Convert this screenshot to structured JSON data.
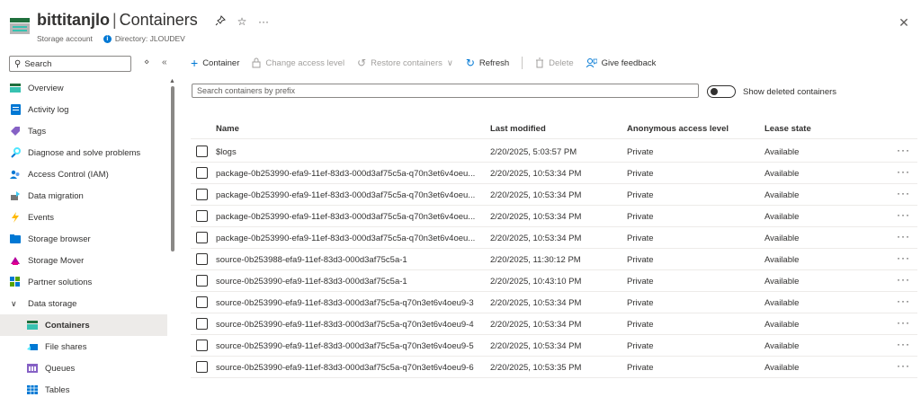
{
  "header": {
    "resource_name": "bittitanjlo",
    "separator": "|",
    "page_title": "Containers",
    "resource_type": "Storage account",
    "directory": "Directory: JLOUDEV"
  },
  "sidebar": {
    "search_placeholder": "Search",
    "items": [
      {
        "label": "Overview",
        "icon": "overview-icon"
      },
      {
        "label": "Activity log",
        "icon": "activity-log-icon"
      },
      {
        "label": "Tags",
        "icon": "tag-icon"
      },
      {
        "label": "Diagnose and solve problems",
        "icon": "wrench-icon"
      },
      {
        "label": "Access Control (IAM)",
        "icon": "people-icon"
      },
      {
        "label": "Data migration",
        "icon": "migration-icon"
      },
      {
        "label": "Events",
        "icon": "lightning-icon"
      },
      {
        "label": "Storage browser",
        "icon": "folder-icon"
      },
      {
        "label": "Storage Mover",
        "icon": "mover-icon"
      },
      {
        "label": "Partner solutions",
        "icon": "grid-icon"
      },
      {
        "label": "Data storage",
        "icon": "chevron-down-icon"
      },
      {
        "label": "Containers",
        "icon": "container-icon"
      },
      {
        "label": "File shares",
        "icon": "file-share-icon"
      },
      {
        "label": "Queues",
        "icon": "queue-icon"
      },
      {
        "label": "Tables",
        "icon": "table-icon"
      }
    ]
  },
  "toolbar": {
    "container": "Container",
    "change_access": "Change access level",
    "restore": "Restore containers",
    "refresh": "Refresh",
    "delete": "Delete",
    "feedback": "Give feedback"
  },
  "filter": {
    "placeholder": "Search containers by prefix",
    "toggle_label": "Show deleted containers"
  },
  "table": {
    "columns": [
      "Name",
      "Last modified",
      "Anonymous access level",
      "Lease state"
    ],
    "rows": [
      {
        "name": "$logs",
        "modified": "2/20/2025, 5:03:57 PM",
        "access": "Private",
        "lease": "Available"
      },
      {
        "name": "package-0b253990-efa9-11ef-83d3-000d3af75c5a-q70n3et6v4oeu...",
        "modified": "2/20/2025, 10:53:34 PM",
        "access": "Private",
        "lease": "Available"
      },
      {
        "name": "package-0b253990-efa9-11ef-83d3-000d3af75c5a-q70n3et6v4oeu...",
        "modified": "2/20/2025, 10:53:34 PM",
        "access": "Private",
        "lease": "Available"
      },
      {
        "name": "package-0b253990-efa9-11ef-83d3-000d3af75c5a-q70n3et6v4oeu...",
        "modified": "2/20/2025, 10:53:34 PM",
        "access": "Private",
        "lease": "Available"
      },
      {
        "name": "package-0b253990-efa9-11ef-83d3-000d3af75c5a-q70n3et6v4oeu...",
        "modified": "2/20/2025, 10:53:34 PM",
        "access": "Private",
        "lease": "Available"
      },
      {
        "name": "source-0b253988-efa9-11ef-83d3-000d3af75c5a-1",
        "modified": "2/20/2025, 11:30:12 PM",
        "access": "Private",
        "lease": "Available"
      },
      {
        "name": "source-0b253990-efa9-11ef-83d3-000d3af75c5a-1",
        "modified": "2/20/2025, 10:43:10 PM",
        "access": "Private",
        "lease": "Available"
      },
      {
        "name": "source-0b253990-efa9-11ef-83d3-000d3af75c5a-q70n3et6v4oeu9-3",
        "modified": "2/20/2025, 10:53:34 PM",
        "access": "Private",
        "lease": "Available"
      },
      {
        "name": "source-0b253990-efa9-11ef-83d3-000d3af75c5a-q70n3et6v4oeu9-4",
        "modified": "2/20/2025, 10:53:34 PM",
        "access": "Private",
        "lease": "Available"
      },
      {
        "name": "source-0b253990-efa9-11ef-83d3-000d3af75c5a-q70n3et6v4oeu9-5",
        "modified": "2/20/2025, 10:53:34 PM",
        "access": "Private",
        "lease": "Available"
      },
      {
        "name": "source-0b253990-efa9-11ef-83d3-000d3af75c5a-q70n3et6v4oeu9-6",
        "modified": "2/20/2025, 10:53:35 PM",
        "access": "Private",
        "lease": "Available"
      }
    ]
  },
  "colors": {
    "accent": "#0078d4",
    "selected_bg": "#edebe9",
    "disabled": "#a19f9d"
  }
}
